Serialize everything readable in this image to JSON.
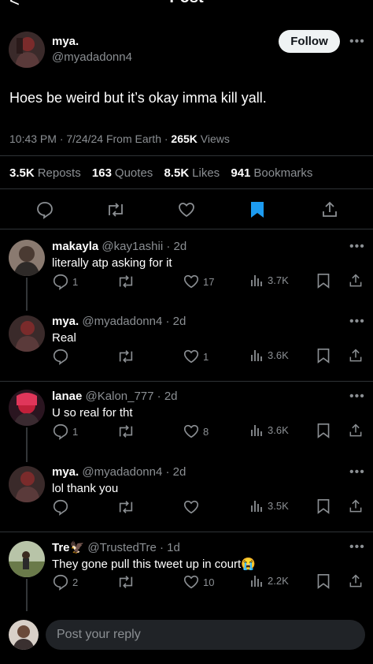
{
  "header": {
    "title": "Post",
    "back": "<"
  },
  "post": {
    "author_name": "mya.",
    "author_handle": "@myadadonn4",
    "follow_label": "Follow",
    "text": "Hoes be weird but it’s okay imma kill yall.",
    "time": "10:43 PM · 7/24/24 From Earth · ",
    "views_count": "265K",
    "views_label": " Views",
    "stats": {
      "reposts_count": "3.5K",
      "reposts_label": "Reposts",
      "quotes_count": "163",
      "quotes_label": "Quotes",
      "likes_count": "8.5K",
      "likes_label": "Likes",
      "bookmarks_count": "941",
      "bookmarks_label": "Bookmarks"
    }
  },
  "replies": [
    {
      "name": "makayla",
      "handle": "@kay1ashii · 2d",
      "text": "literally atp asking for it",
      "replies": "1",
      "likes": "17",
      "views": "3.7K"
    },
    {
      "name": "mya.",
      "handle": "@myadadonn4 · 2d",
      "text": "Real",
      "replies": "",
      "likes": "1",
      "views": "3.6K"
    },
    {
      "name": "lanae",
      "handle": "@Kalon_777 · 2d",
      "text": "U so real for tht",
      "replies": "1",
      "likes": "8",
      "views": "3.6K"
    },
    {
      "name": "mya.",
      "handle": "@myadadonn4 · 2d",
      "text": "lol thank you",
      "replies": "",
      "likes": "",
      "views": "3.5K"
    },
    {
      "name": "Tre🦅",
      "handle": "@TrustedTre · 1d",
      "text": "They gone pull this tweet up in court😭",
      "replies": "2",
      "likes": "10",
      "views": "2.2K"
    }
  ],
  "composer": {
    "placeholder": "Post your reply"
  },
  "colors": {
    "accent": "#1d9bf0",
    "muted": "#8b8f93",
    "bg": "#000000"
  }
}
